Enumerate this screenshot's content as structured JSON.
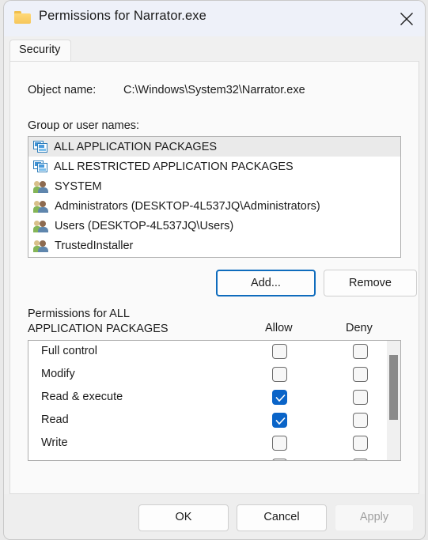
{
  "window": {
    "title": "Permissions for Narrator.exe",
    "folder_icon": "folder-icon",
    "close_icon": "close-icon"
  },
  "tabs": [
    {
      "label": "Security",
      "selected": true
    }
  ],
  "object_name": {
    "label": "Object name:",
    "value": "C:\\Windows\\System32\\Narrator.exe"
  },
  "group_section": {
    "label": "Group or user names:",
    "items": [
      {
        "name": "ALL APPLICATION PACKAGES",
        "icon": "application-package-icon",
        "selected": true
      },
      {
        "name": "ALL RESTRICTED APPLICATION PACKAGES",
        "icon": "application-package-icon",
        "selected": false
      },
      {
        "name": "SYSTEM",
        "icon": "users-group-icon",
        "selected": false
      },
      {
        "name": "Administrators (DESKTOP-4L537JQ\\Administrators)",
        "icon": "users-group-icon",
        "selected": false
      },
      {
        "name": "Users (DESKTOP-4L537JQ\\Users)",
        "icon": "users-group-icon",
        "selected": false
      },
      {
        "name": "TrustedInstaller",
        "icon": "users-group-icon",
        "selected": false
      }
    ],
    "add_label": "Add...",
    "remove_label": "Remove"
  },
  "annotation": {
    "arrow_color": "#e8332f",
    "points_to": "Add..."
  },
  "permissions_section": {
    "title_line1": "Permissions for ALL",
    "title_line2": "APPLICATION PACKAGES",
    "col_allow": "Allow",
    "col_deny": "Deny",
    "rows": [
      {
        "label": "Full control",
        "allow": false,
        "deny": false
      },
      {
        "label": "Modify",
        "allow": false,
        "deny": false
      },
      {
        "label": "Read & execute",
        "allow": true,
        "deny": false
      },
      {
        "label": "Read",
        "allow": true,
        "deny": false
      },
      {
        "label": "Write",
        "allow": false,
        "deny": false
      }
    ]
  },
  "footer": {
    "ok_label": "OK",
    "cancel_label": "Cancel",
    "apply_label": "Apply",
    "apply_enabled": false
  },
  "colors": {
    "accent": "#0a64c8",
    "focus_border": "#0f6cbd",
    "annotation_red": "#e8332f",
    "titlebar": "#eef1f9"
  }
}
